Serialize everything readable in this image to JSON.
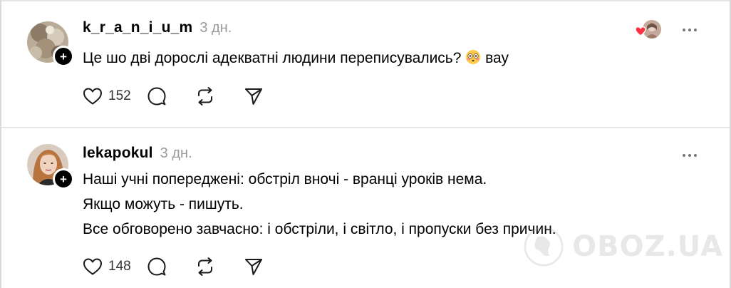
{
  "posts": [
    {
      "username": "k_r_a_n_i_u_m",
      "timestamp": "3 дн.",
      "lines": [
        "Це шо дві дорослі адекватні людини переписувались?",
        "вау"
      ],
      "likes": "152",
      "liked_by_author": true
    },
    {
      "username": "lekapokul",
      "timestamp": "3 дн.",
      "lines": [
        "Наші учні попереджені: обстріл вночі - вранці уроків нема.",
        "Якщо можуть - пишуть.",
        "Все обговорено завчасно: і обстріли, і світло, і пропуски без причин."
      ],
      "likes": "148",
      "liked_by_author": false
    }
  ],
  "watermark": {
    "logo_text": "OBOZ.UA",
    "logo_icon": "oboz-globe-icon"
  },
  "colors": {
    "heart_red": "#ff3040",
    "timestamp_gray": "#9a9a9a",
    "icon_dark": "#1a1a1a"
  }
}
